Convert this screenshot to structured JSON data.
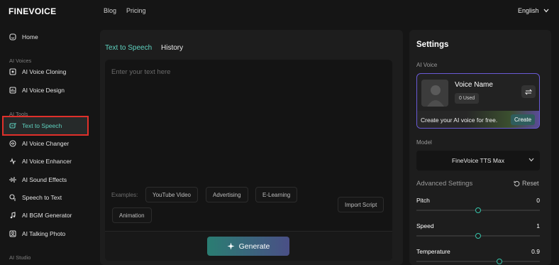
{
  "header": {
    "logo": "FINEVOICE",
    "nav": [
      "Blog",
      "Pricing"
    ],
    "language": "English"
  },
  "sidebar": {
    "home": "Home",
    "sections": {
      "ai_voices": "AI Voices",
      "ai_tools": "AI Tools",
      "ai_studio": "AI Studio"
    },
    "voices_items": [
      "AI Voice Cloning",
      "AI Voice Design"
    ],
    "tools_items": [
      "Text to Speech",
      "AI Voice Changer",
      "AI Voice Enhancer",
      "AI Sound Effects",
      "Speech to Text",
      "AI BGM Generator",
      "AI Talking Photo"
    ],
    "active_item": "Text to Speech"
  },
  "main": {
    "tabs": [
      "Text to Speech",
      "History"
    ],
    "active_tab": "Text to Speech",
    "editor_placeholder": "Enter your text here",
    "examples_label": "Examples:",
    "examples": [
      "YouTube Video",
      "Advertising",
      "E-Learning",
      "Animation"
    ],
    "import_script": "Import Script",
    "generate": "Generate"
  },
  "settings": {
    "title": "Settings",
    "ai_voice_label": "AI Voice",
    "voice_name": "Voice Name",
    "used": "0 Used",
    "create_prompt": "Create your AI voice for free.",
    "create_button": "Create",
    "model_label": "Model",
    "model_value": "FineVoice TTS Max",
    "advanced_title": "Advanced Settings",
    "reset": "Reset",
    "sliders": [
      {
        "label": "Pitch",
        "value": "0",
        "fraction": 0.5
      },
      {
        "label": "Speed",
        "value": "1",
        "fraction": 0.5
      },
      {
        "label": "Temperature",
        "value": "0.9",
        "fraction": 0.67
      }
    ]
  },
  "colors": {
    "accent": "#5fd3c0",
    "highlight_box": "#e0302a",
    "voice_card_border": "#6a5bd6"
  }
}
